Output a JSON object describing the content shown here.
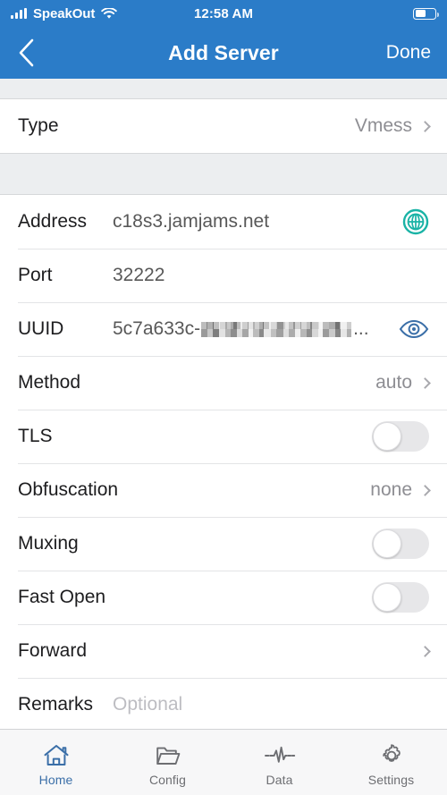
{
  "status_bar": {
    "carrier": "SpeakOut",
    "time": "12:58 AM",
    "signal_icon": "signal-bars-icon",
    "wifi_icon": "wifi-icon",
    "battery_icon": "battery-icon",
    "battery_level_percent": 55
  },
  "nav": {
    "back_icon": "chevron-left-icon",
    "title": "Add Server",
    "done_label": "Done"
  },
  "colors": {
    "header_blue": "#2b7cc8",
    "accent_blue": "#3b6fa8",
    "globe_teal": "#1ab3a6",
    "page_bg": "#eceef0",
    "row_bg": "#ffffff",
    "label_text": "#1d1d1f",
    "value_text": "#585858",
    "muted_text": "#8e8e93",
    "placeholder_text": "#bdbdc2"
  },
  "form": {
    "type_group": [
      {
        "label": "Type",
        "value": "Vmess",
        "control": "disclosure",
        "accessory_icon": "chevron-right-icon"
      }
    ],
    "details_group": [
      {
        "label": "Address",
        "value": "c18s3.jamjams.net",
        "control": "text",
        "accessory_icon": "globe-icon"
      },
      {
        "label": "Port",
        "value": "32222",
        "control": "text",
        "accessory_icon": null
      },
      {
        "label": "UUID",
        "value": "5c7a633c-",
        "value_redacted": true,
        "value_suffix": "...",
        "control": "secure-text",
        "accessory_icon": "eye-icon"
      },
      {
        "label": "Method",
        "value": "auto",
        "control": "disclosure",
        "accessory_icon": "chevron-right-icon"
      },
      {
        "label": "TLS",
        "value": "",
        "control": "toggle",
        "toggle_on": false
      },
      {
        "label": "Obfuscation",
        "value": "none",
        "control": "disclosure",
        "accessory_icon": "chevron-right-icon"
      },
      {
        "label": "Muxing",
        "value": "",
        "control": "toggle",
        "toggle_on": false
      },
      {
        "label": "Fast Open",
        "value": "",
        "control": "toggle",
        "toggle_on": false
      },
      {
        "label": "Forward",
        "value": "",
        "control": "disclosure",
        "accessory_icon": "chevron-right-icon"
      },
      {
        "label": "Remarks",
        "value": "",
        "placeholder": "Optional",
        "control": "text",
        "accessory_icon": null
      }
    ]
  },
  "tabbar": {
    "items": [
      {
        "label": "Home",
        "icon": "home-icon",
        "active": true
      },
      {
        "label": "Config",
        "icon": "folder-icon",
        "active": false
      },
      {
        "label": "Data",
        "icon": "pulse-icon",
        "active": false
      },
      {
        "label": "Settings",
        "icon": "gear-icon",
        "active": false
      }
    ]
  }
}
